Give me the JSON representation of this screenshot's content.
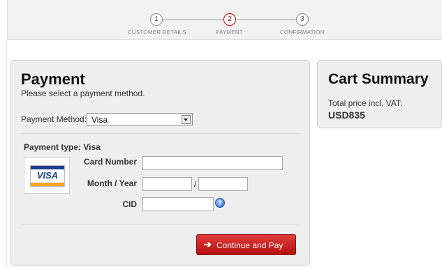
{
  "steps": [
    {
      "number": "1",
      "label": "CUSTOMER DETAILS",
      "active": false
    },
    {
      "number": "2",
      "label": "PAYMENT",
      "active": true
    },
    {
      "number": "3",
      "label": "CONFIRMATION",
      "active": false
    }
  ],
  "payment": {
    "title": "Payment",
    "subtitle": "Please select a payment method.",
    "method_label": "Payment Method:",
    "method_value": "Visa",
    "type_label": "Payment type: Visa",
    "card_logo_text": "VISA",
    "card_number_label": "Card Number",
    "card_number_value": "",
    "month_year_label": "Month / Year",
    "month_value": "",
    "year_value": "",
    "slash": "/",
    "cid_label": "CID",
    "cid_value": "",
    "help_icon": "question-mark-icon",
    "continue_arrow": "➔",
    "continue_label": "Continue and Pay"
  },
  "cart": {
    "title": "Cart Summary",
    "total_label": "Total price incl. VAT:",
    "total_value": "USD835"
  },
  "colors": {
    "accent_red": "#c00000",
    "panel_bg": "#efefef",
    "topbar_bg": "#f2f2f2",
    "visa_blue": "#1a3e8c",
    "visa_gold": "#f5a41d"
  }
}
